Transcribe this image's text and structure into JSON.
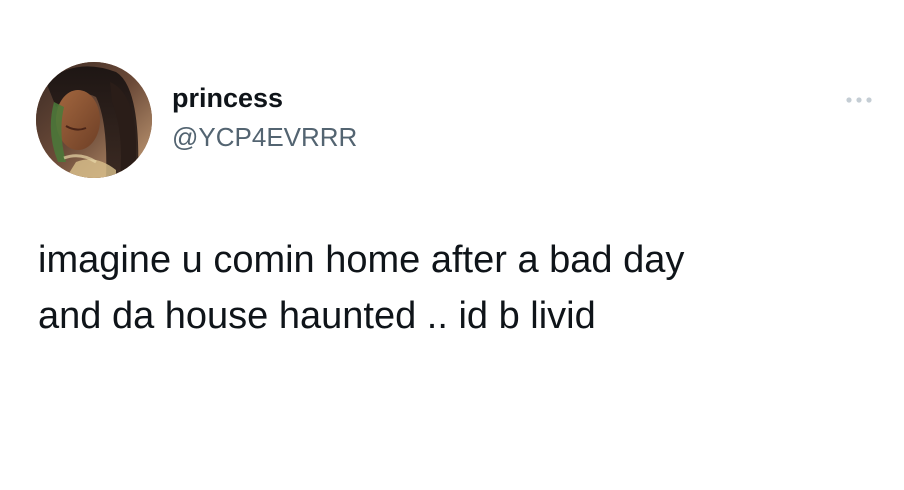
{
  "tweet": {
    "author": {
      "display_name": "princess",
      "handle": "@YCP4EVRRR",
      "avatar_icon": "profile-photo"
    },
    "text": "imagine u comin home after a bad day\nand da house haunted .. id b livid",
    "more_icon": "more-dots-icon"
  }
}
